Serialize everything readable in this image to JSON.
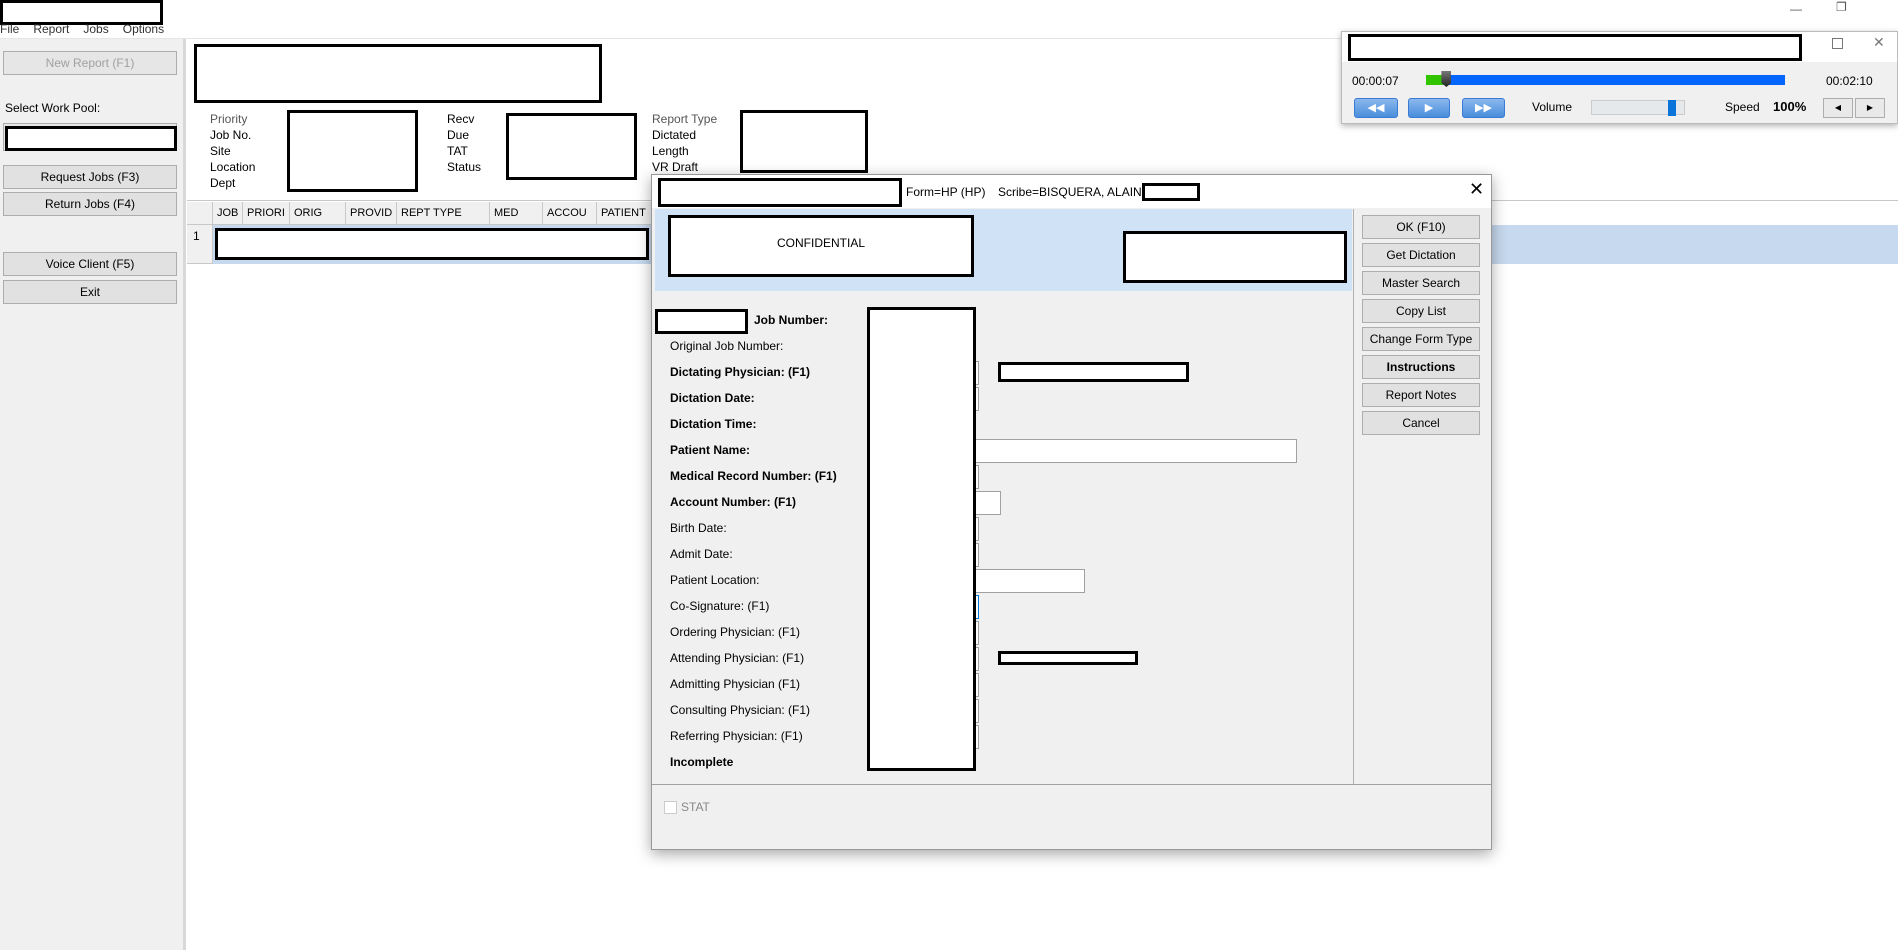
{
  "menu": [
    "File",
    "Report",
    "Jobs",
    "Options"
  ],
  "sidebar": {
    "new_report": "New Report (F1)",
    "work_pool_label": "Select Work Pool:",
    "request_jobs": "Request Jobs (F3)",
    "return_jobs": "Return Jobs (F4)",
    "voice_client": "Voice Client (F5)",
    "exit": "Exit"
  },
  "info": {
    "col1": [
      "Priority",
      "Job No.",
      "Site",
      "Location",
      "Dept"
    ],
    "col2": [
      "Recv",
      "Due",
      "TAT",
      "Status"
    ],
    "col3": [
      "Report Type",
      "Dictated",
      "Length",
      "VR Draft"
    ]
  },
  "grid": {
    "columns": [
      "JOB",
      "PRIORI",
      "ORIG",
      "PROVID",
      "REPT TYPE",
      "MED",
      "ACCOU",
      "PATIENT"
    ],
    "row_number": "1"
  },
  "audio": {
    "elapsed": "00:00:07",
    "total": "00:02:10",
    "progress_percent": 5.4,
    "volume_label": "Volume",
    "volume_percent": 90,
    "speed_label": "Speed",
    "speed": "100%"
  },
  "dialog": {
    "form": "Form=HP (HP)",
    "scribe": "Scribe=BISQUERA, ALAINE",
    "confidential": "CONFIDENTIAL",
    "buttons": [
      "OK  (F10)",
      "Get Dictation",
      "Master Search",
      "Copy List",
      "Change Form Type",
      "Instructions",
      "Report Notes",
      "Cancel"
    ],
    "fields": [
      {
        "label": "Job Number:",
        "bold": true
      },
      {
        "label": "Original Job Number:",
        "bold": false
      },
      {
        "label": "Dictating Physician: (F1)",
        "bold": true
      },
      {
        "label": "Dictation Date:",
        "bold": true
      },
      {
        "label": "Dictation Time:",
        "bold": true
      },
      {
        "label": "Patient Name:",
        "bold": true
      },
      {
        "label": "Medical Record Number: (F1)",
        "bold": true
      },
      {
        "label": "Account Number: (F1)",
        "bold": true
      },
      {
        "label": "Birth Date:",
        "bold": false
      },
      {
        "label": "Admit Date:",
        "bold": false
      },
      {
        "label": "Patient Location:",
        "bold": false
      },
      {
        "label": "Co-Signature: (F1)",
        "bold": false
      },
      {
        "label": "Ordering Physician: (F1)",
        "bold": false
      },
      {
        "label": "Attending Physician: (F1)",
        "bold": false
      },
      {
        "label": "Admitting Physician (F1)",
        "bold": false
      },
      {
        "label": "Consulting Physician: (F1)",
        "bold": false
      },
      {
        "label": "Referring Physician: (F1)",
        "bold": false
      },
      {
        "label": "Incomplete",
        "bold": true
      }
    ],
    "stat_label": "STAT",
    "stat_checked": false
  },
  "colors": {
    "selection": "#c7d9ef",
    "banner": "#cfe2f6",
    "progress_played": "#33c400",
    "progress_remaining": "#0066ff"
  }
}
